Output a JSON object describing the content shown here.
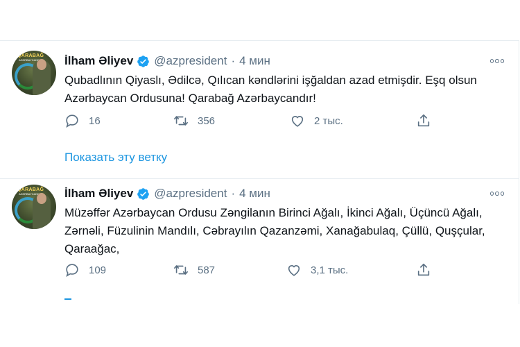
{
  "tweets": [
    {
      "name": "İlham Əliyev",
      "handle": "@azpresident",
      "separator": "·",
      "time": "4 мин",
      "text": "Qubadlının Qiyaslı, Ədilcə, Qılıcan kəndlərini işğaldan azad etmişdir. Eşq olsun Azərbaycan Ordusuna! Qarabağ Azərbaycandır!",
      "replies": "16",
      "retweets": "356",
      "likes": "2 тыс.",
      "show_thread": "Показать эту ветку",
      "avatar_caption": "QARABAĞ",
      "avatar_subcaption": "AZƏRBAYCANDIR"
    },
    {
      "name": "İlham Əliyev",
      "handle": "@azpresident",
      "separator": "·",
      "time": "4 мин",
      "text": "Müzəffər Azərbaycan Ordusu Zəngilanın Birinci Ağalı, İkinci Ağalı, Üçüncü Ağalı, Zərnəli, Füzulinin Mandılı, Cəbrayılın Qazanzəmi, Xanağabulaq, Çüllü, Quşçular, Qaraağac,",
      "replies": "109",
      "retweets": "587",
      "likes": "3,1 тыс.",
      "avatar_caption": "QARABAĞ",
      "avatar_subcaption": "AZƏRBAYCANDIR"
    }
  ],
  "icons": {
    "verified": "verified-badge-icon",
    "more": "more-options-icon",
    "reply": "reply-icon",
    "retweet": "retweet-icon",
    "like": "like-icon",
    "share": "share-icon"
  },
  "colors": {
    "link": "#1b95e0",
    "verified": "#1da1f2",
    "secondary_text": "#5b7083",
    "border": "#e6ecf0"
  }
}
